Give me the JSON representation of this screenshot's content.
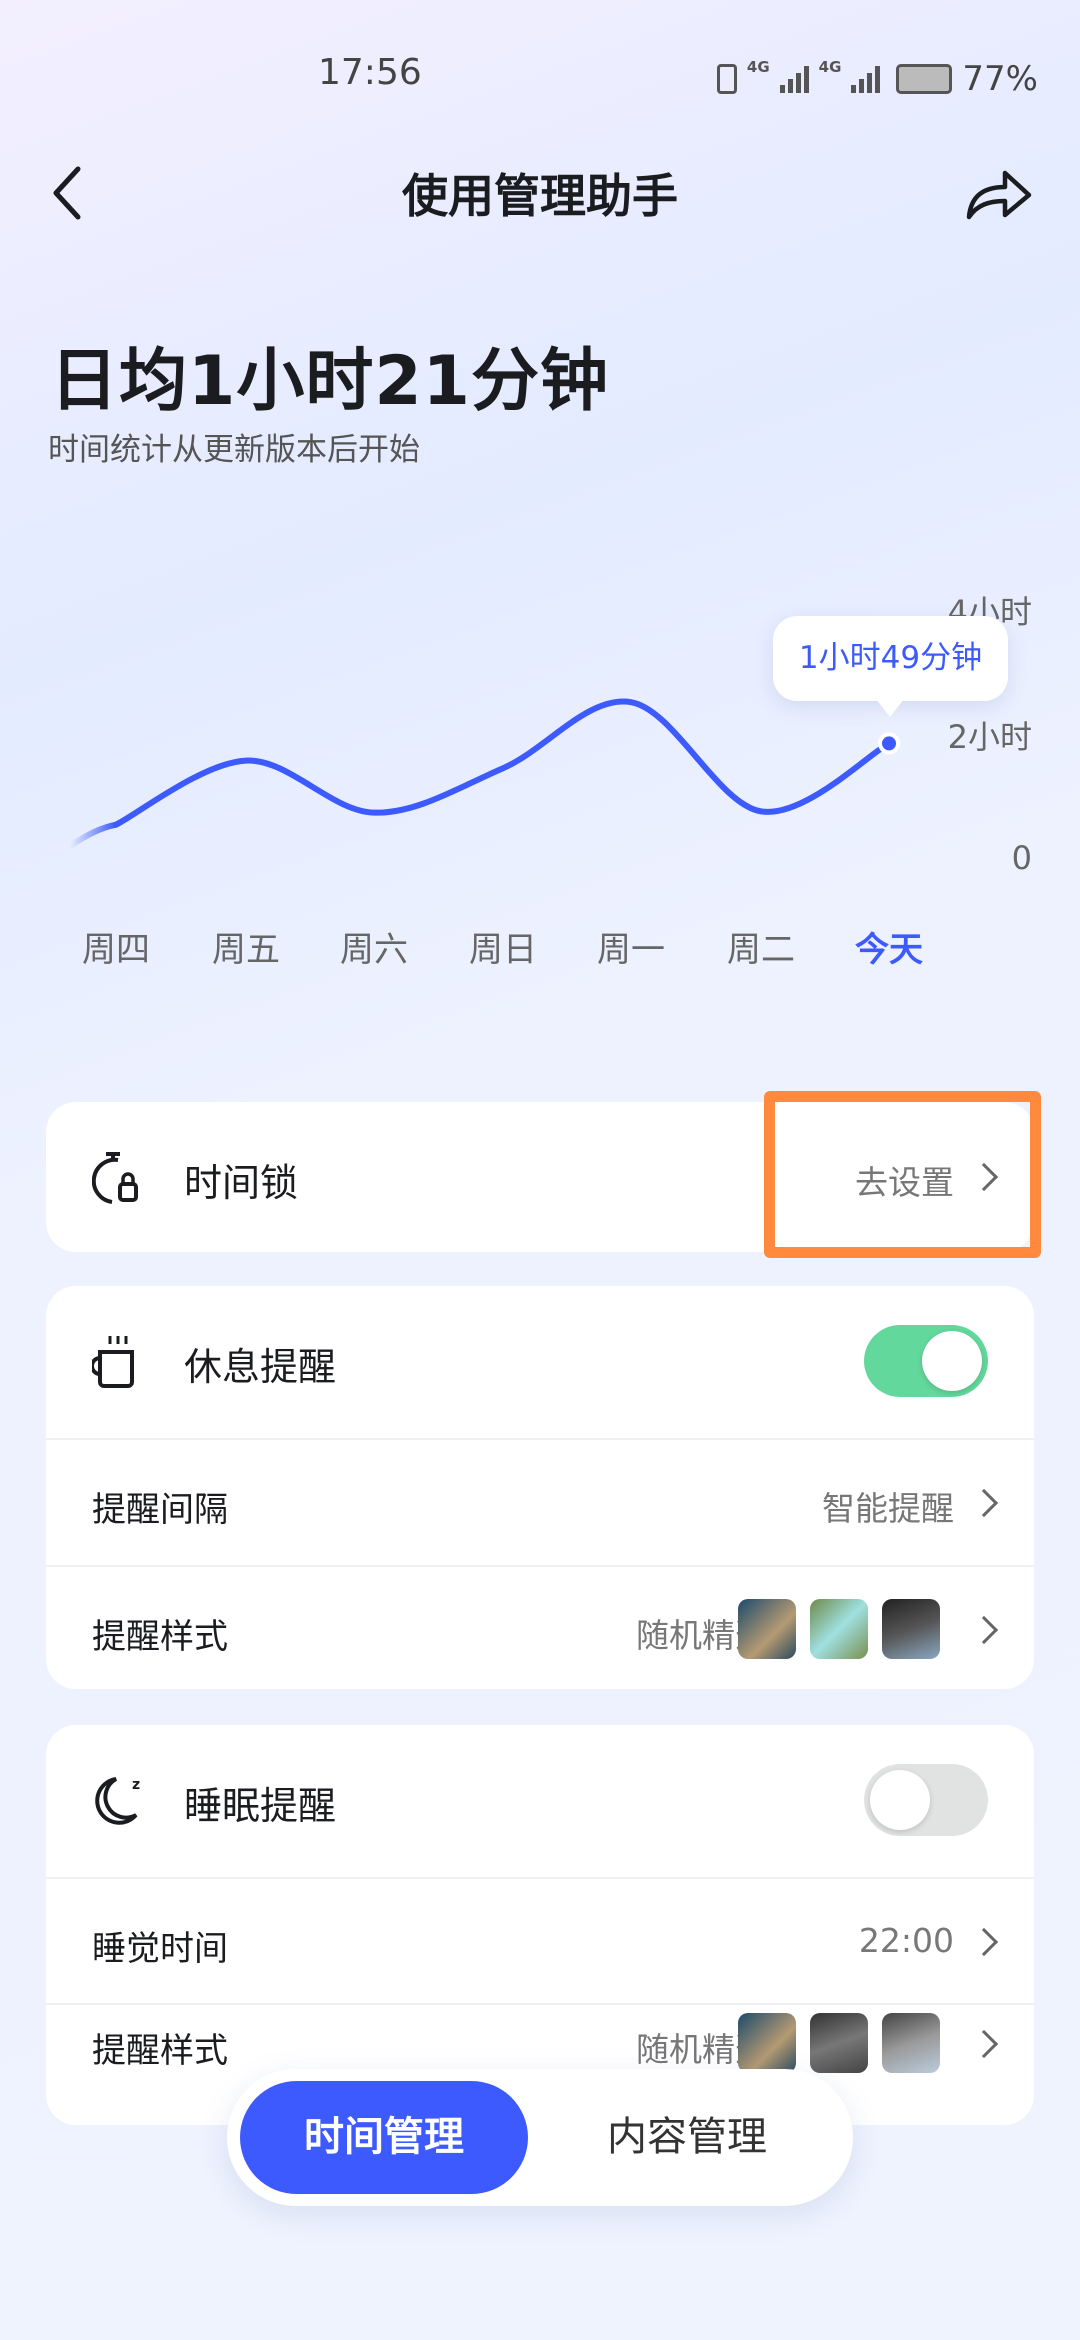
{
  "status_bar": {
    "time": "17:56",
    "battery": "77%",
    "network": [
      "4G",
      "4G"
    ]
  },
  "header": {
    "title": "使用管理助手",
    "back_icon": "chevron-left-icon",
    "share_icon": "share-icon"
  },
  "summary": {
    "headline": "日均1小时21分钟",
    "note": "时间统计从更新版本后开始"
  },
  "chart_data": {
    "type": "line",
    "categories": [
      "周四",
      "周五",
      "周六",
      "周日",
      "周一",
      "周二",
      "今天"
    ],
    "values": [
      0.54,
      1.55,
      0.73,
      1.43,
      2.47,
      0.75,
      1.82
    ],
    "y_unit": "hours",
    "yticks": [
      "0",
      "2小时",
      "4小时"
    ],
    "ylim": [
      0,
      4
    ],
    "highlight_label": "1小时49分钟",
    "highlight_index": 6,
    "line_color": "#3d5afe",
    "grid": false
  },
  "cards": {
    "time_lock": {
      "label": "时间锁",
      "action": "去设置"
    },
    "rest": {
      "label": "休息提醒",
      "toggle_on": true,
      "rows": [
        {
          "label": "提醒间隔",
          "value": "智能提醒"
        },
        {
          "label": "提醒样式",
          "value": "随机精选"
        }
      ]
    },
    "sleep": {
      "label": "睡眠提醒",
      "toggle_on": false,
      "rows": [
        {
          "label": "睡觉时间",
          "value": "22:00"
        },
        {
          "label": "提醒样式",
          "value": "随机精选"
        }
      ]
    }
  },
  "tabs": [
    {
      "label": "时间管理",
      "active": true
    },
    {
      "label": "内容管理",
      "active": false
    }
  ],
  "colors": {
    "accent": "#3d5afe",
    "toggle_on": "#63d89c",
    "highlight_box": "#ff8a3d"
  }
}
